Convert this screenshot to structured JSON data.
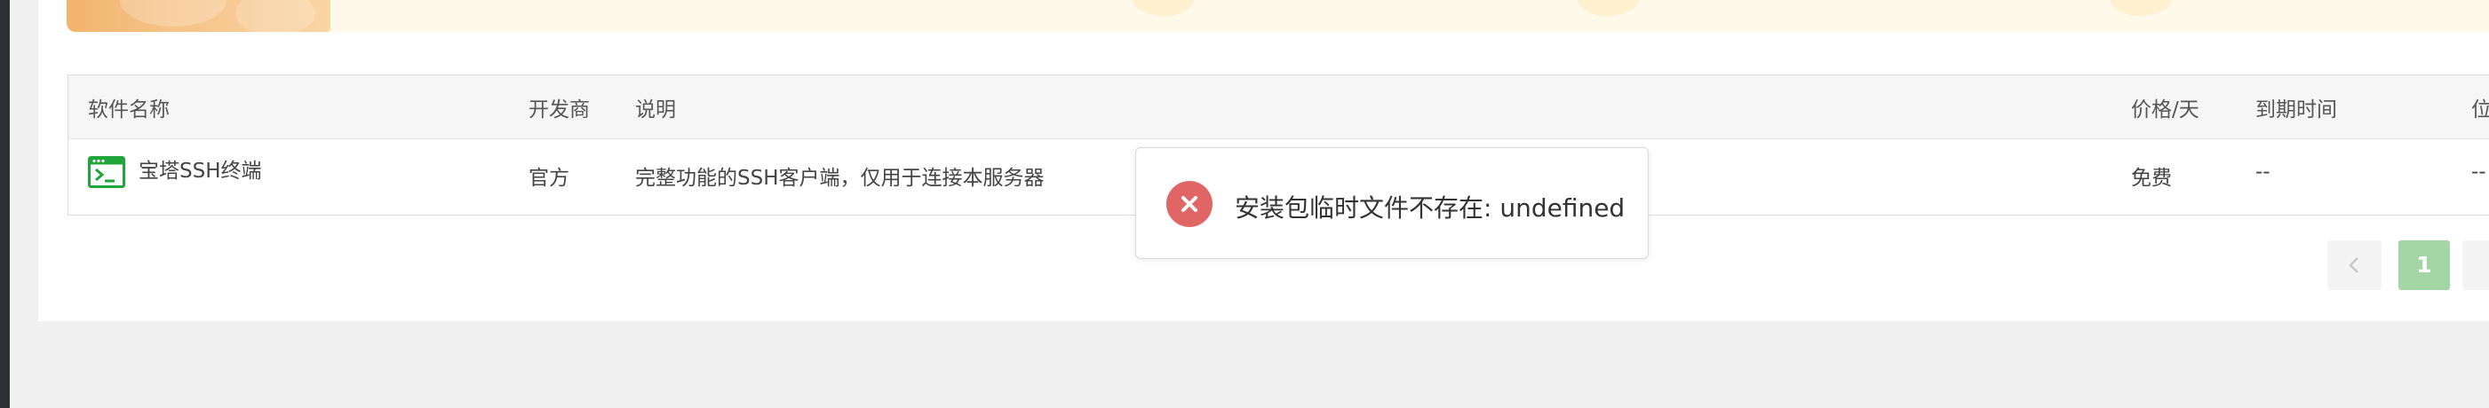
{
  "table": {
    "headers": [
      "软件名称",
      "开发商",
      "说明",
      "价格/天",
      "到期时间",
      "位"
    ],
    "rows": [
      {
        "name": "宝塔SSH终端",
        "developer": "官方",
        "description": "完整功能的SSH客户端，仅用于连接本服务器",
        "price": "免费",
        "expiry": "--",
        "position": "--"
      }
    ]
  },
  "toast": {
    "message": "安装包临时文件不存在: undefined",
    "icon": "error-x-icon",
    "color": "#e06666"
  },
  "pagination": {
    "prev_icon": "chevron-left-icon",
    "current_page": "1",
    "active_color": "#a3d5a6"
  },
  "colors": {
    "accent": "#20a53a",
    "error": "#e06666"
  }
}
